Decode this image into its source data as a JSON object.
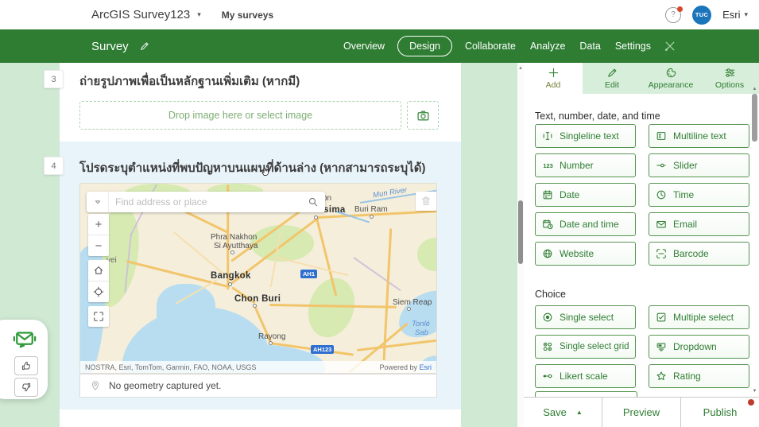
{
  "colors": {
    "accent": "#2e7d32",
    "accent_light": "#d7eeda",
    "selection_blue": "#e9f4fa",
    "notification": "#d9472b",
    "map_water": "#b9ddf0"
  },
  "topbar": {
    "app_title": "ArcGIS Survey123",
    "my_surveys": "My surveys",
    "account_name": "Esri",
    "avatar_text": "TUC",
    "help_icon": "question-circle"
  },
  "navbar": {
    "title": "Survey",
    "tabs": [
      "Overview",
      "Design",
      "Collaborate",
      "Analyze",
      "Data",
      "Settings"
    ],
    "active_tab": "Design"
  },
  "form": {
    "q3": {
      "number": "3",
      "title": "ถ่ายรูปภาพเพื่อเป็นหลักฐานเพิ่มเติม (หากมี)",
      "dropzone_label": "Drop image here or select image",
      "camera_icon": "camera"
    },
    "q4": {
      "number": "4",
      "title": "โปรดระบุตำแหน่งที่พบปัญหาบนแผนที่ด้านล่าง (หากสามารถระบุได้)",
      "geometry_status": "No geometry captured yet.",
      "map": {
        "search_placeholder": "Find address or place",
        "zoom_in": "+",
        "zoom_out": "−",
        "labels": {
          "nakhon_partial": "on",
          "ratchasima": "Ratchasima",
          "buri_ram": "Buri Ram",
          "mun_river": "Mun River",
          "ayutthaya1": "Phra Nakhon",
          "ayutthaya2": "Si Ayutthaya",
          "bangkok": "Bangkok",
          "chon_buri": "Chon Buri",
          "rayong": "Rayong",
          "siem_reap": "Siem Reap",
          "tonle1": "Tonlé",
          "tonle2": "Sab",
          "dawei_partial": "vei"
        },
        "shields": {
          "ah1": "AH1",
          "ah123": "AH123"
        },
        "attribution": "NOSTRA, Esri, TomTom, Garmin, FAO, NOAA, USGS",
        "powered_by": "Powered by ",
        "powered_brand": "Esri"
      }
    }
  },
  "panel": {
    "tabs": [
      {
        "label": "Add",
        "icon": "plus"
      },
      {
        "label": "Edit",
        "icon": "pencil"
      },
      {
        "label": "Appearance",
        "icon": "palette"
      },
      {
        "label": "Options",
        "icon": "sliders"
      }
    ],
    "sections": [
      {
        "title": "Text, number, date, and time",
        "items": [
          "Singleline text",
          "Multiline text",
          "Number",
          "Slider",
          "Date",
          "Time",
          "Date and time",
          "Email",
          "Website",
          "Barcode"
        ]
      },
      {
        "title": "Choice",
        "items": [
          "Single select",
          "Multiple select",
          "Single select grid",
          "Dropdown",
          "Likert scale",
          "Rating"
        ]
      }
    ],
    "footer": {
      "save": "Save",
      "preview": "Preview",
      "publish": "Publish"
    }
  }
}
